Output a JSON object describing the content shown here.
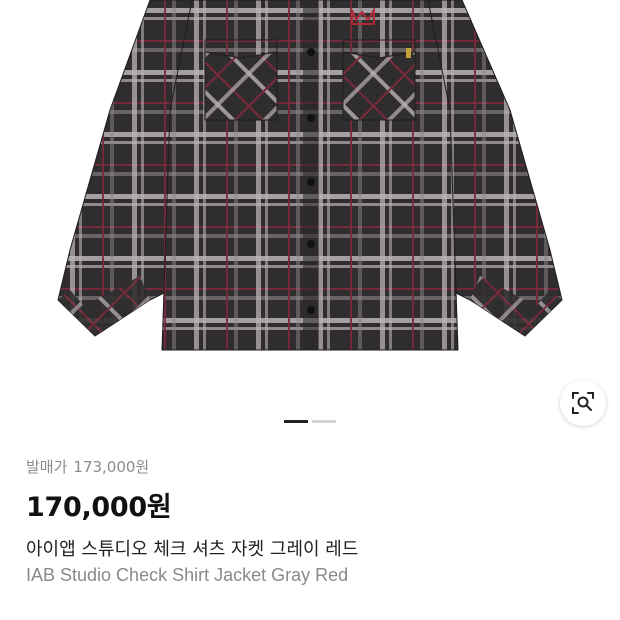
{
  "product": {
    "image_alt": "plaid-check-shirt-jacket",
    "release_label": "발매가",
    "release_price": "173,000원",
    "price": "170,000원",
    "name_ko": "아이앱 스튜디오 체크 셔츠 자켓 그레이 레드",
    "name_en": "IAB Studio Check Shirt Jacket Gray Red"
  },
  "carousel": {
    "current": 1,
    "total": 2
  },
  "icons": {
    "lens": "lens-search-icon"
  },
  "colors": {
    "shirt_base": "#2f2d2d",
    "plaid_light": "#b9b3b6",
    "plaid_red": "#7a2a3a",
    "price_text": "#111111",
    "muted_text": "#8c8c8c"
  }
}
